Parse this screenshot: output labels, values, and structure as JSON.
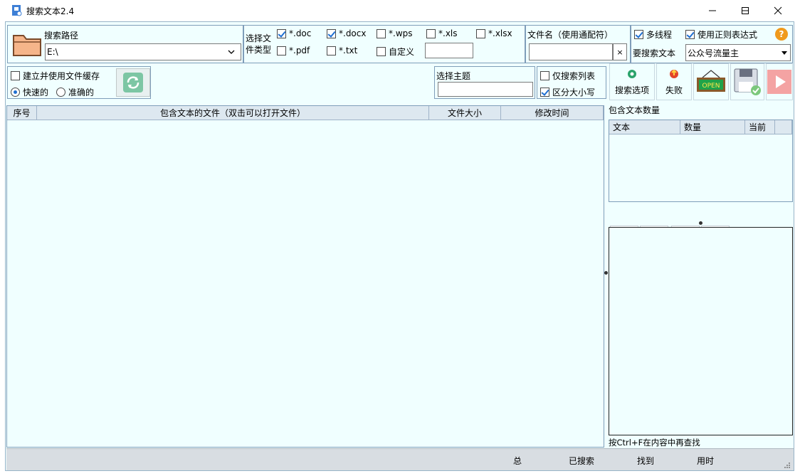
{
  "window": {
    "title": "搜索文本2.4"
  },
  "path": {
    "label": "搜索路径",
    "value": "E:\\"
  },
  "filetypes": {
    "label": "选择文件类型",
    "items": [
      {
        "label": "*.doc",
        "checked": true
      },
      {
        "label": "*.docx",
        "checked": true
      },
      {
        "label": "*.wps",
        "checked": false
      },
      {
        "label": "*.xls",
        "checked": false
      },
      {
        "label": "*.xlsx",
        "checked": false
      },
      {
        "label": "*.pdf",
        "checked": false
      },
      {
        "label": "*.txt",
        "checked": false
      },
      {
        "label": "自定义",
        "checked": false
      }
    ],
    "custom_value": ""
  },
  "filename": {
    "label": "文件名（使用通配符）",
    "value": "",
    "clear_label": "×"
  },
  "options": {
    "multithread": {
      "label": "多线程",
      "checked": true
    },
    "regex": {
      "label": "使用正则表达式",
      "checked": true
    },
    "help_label": "?",
    "search_text_label": "要搜索文本",
    "search_text_value": "公众号流量主"
  },
  "cache": {
    "label": "建立并使用文件缓存",
    "checked": false,
    "fast_label": "快速的",
    "accurate_label": "准确的",
    "mode": "fast"
  },
  "theme": {
    "label": "选择主题",
    "value": ""
  },
  "search_list": {
    "only_list": {
      "label": "仅搜索列表",
      "checked": false
    },
    "case": {
      "label": "区分大小写",
      "checked": true
    }
  },
  "toolbar": {
    "search_options": "搜索选项",
    "fail": "失败",
    "open": "OPEN"
  },
  "results_table": {
    "columns": [
      "序号",
      "包含文本的文件（双击可以打开文件）",
      "文件大小",
      "修改时间"
    ],
    "rows": []
  },
  "count_panel": {
    "title": "包含文本数量",
    "columns": [
      "文本",
      "数量",
      "当前"
    ],
    "rows": []
  },
  "hint": "按Ctrl+F在内容中再查找",
  "status": {
    "total": "总",
    "searched": "已搜索",
    "found": "找到",
    "time": "用时"
  },
  "colors": {
    "bg": "#f0ffff",
    "accent": "#1f6fd1",
    "folder": "#f5b58a",
    "play": "#f4a3a3"
  }
}
